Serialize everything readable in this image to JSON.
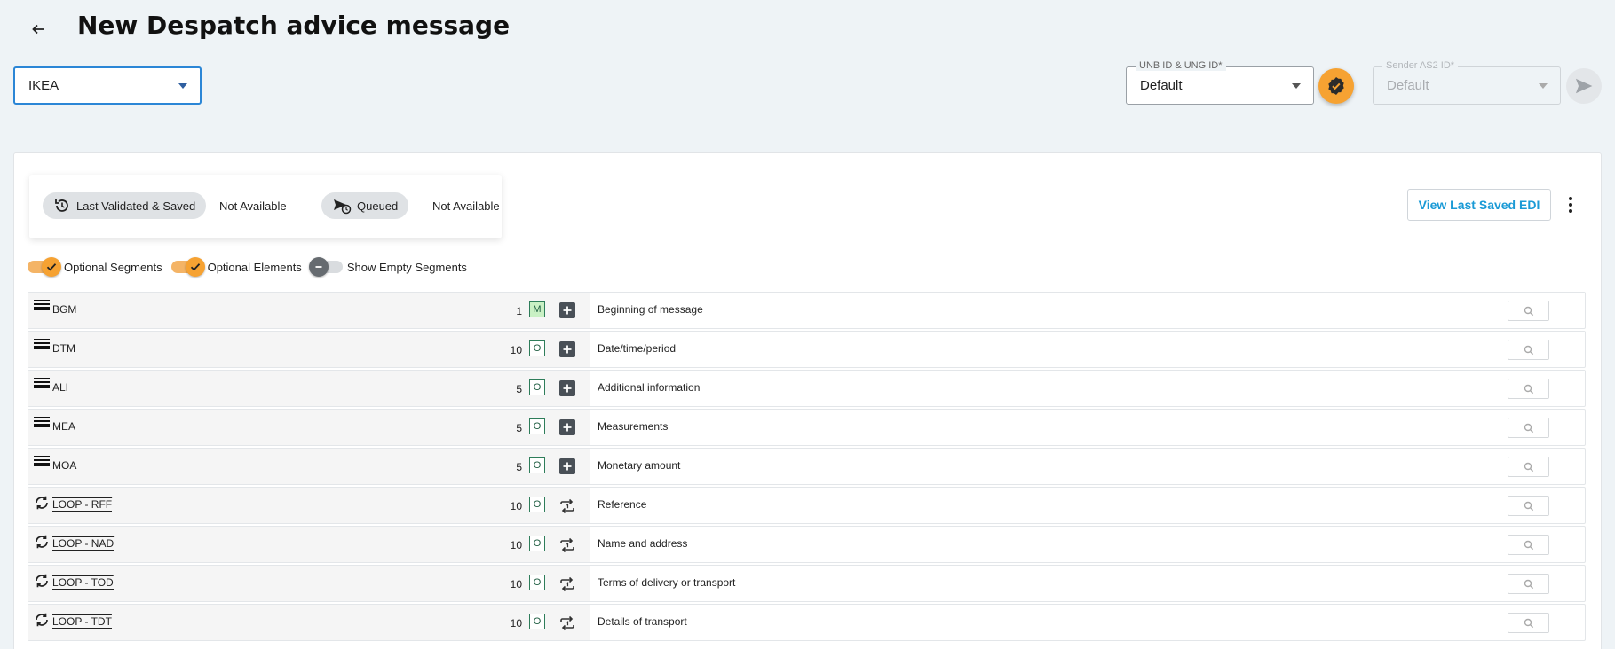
{
  "header": {
    "title": "New Despatch advice message"
  },
  "partner_select": {
    "value": "IKEA"
  },
  "unb_field": {
    "label": "UNB ID & UNG ID*",
    "value": "Default"
  },
  "sender_field": {
    "label": "Sender AS2 ID*",
    "value": "Default"
  },
  "status": {
    "last_validated_label": "Last Validated & Saved",
    "last_validated_value": "Not Available",
    "queued_label": "Queued",
    "queued_value": "Not Available"
  },
  "actions": {
    "view_last_saved": "View Last Saved EDI"
  },
  "toggles": {
    "optional_segments": {
      "label": "Optional Segments",
      "on": true
    },
    "optional_elements": {
      "label": "Optional Elements",
      "on": true
    },
    "show_empty": {
      "label": "Show Empty Segments",
      "on": false
    }
  },
  "segments": [
    {
      "name": "BGM",
      "count": "1",
      "badge": "M",
      "kind": "segment",
      "desc": "Beginning of message"
    },
    {
      "name": "DTM",
      "count": "10",
      "badge": "O",
      "kind": "segment",
      "desc": "Date/time/period"
    },
    {
      "name": "ALI",
      "count": "5",
      "badge": "O",
      "kind": "segment",
      "desc": "Additional information"
    },
    {
      "name": "MEA",
      "count": "5",
      "badge": "O",
      "kind": "segment",
      "desc": "Measurements"
    },
    {
      "name": "MOA",
      "count": "5",
      "badge": "O",
      "kind": "segment",
      "desc": "Monetary amount"
    },
    {
      "name": "LOOP - RFF",
      "count": "10",
      "badge": "O",
      "kind": "loop",
      "desc": "Reference"
    },
    {
      "name": "LOOP - NAD",
      "count": "10",
      "badge": "O",
      "kind": "loop",
      "desc": "Name and address"
    },
    {
      "name": "LOOP - TOD",
      "count": "10",
      "badge": "O",
      "kind": "loop",
      "desc": "Terms of delivery or transport"
    },
    {
      "name": "LOOP - TDT",
      "count": "10",
      "badge": "O",
      "kind": "loop",
      "desc": "Details of transport"
    }
  ],
  "colors": {
    "accent": "#f6a232",
    "link": "#1a9ad6",
    "focus": "#2b86d6"
  }
}
